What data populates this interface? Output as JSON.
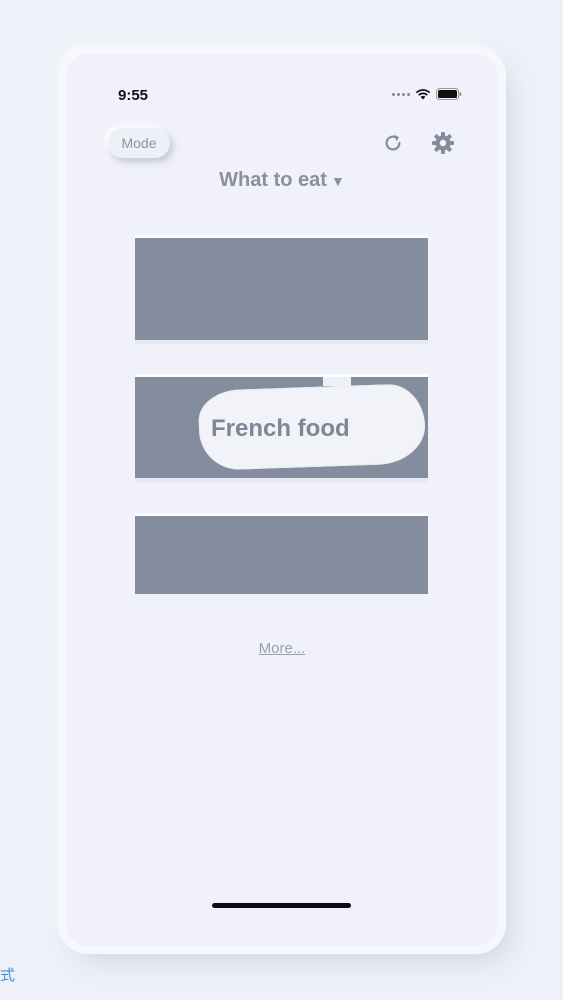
{
  "status_bar": {
    "time": "9:55"
  },
  "header": {
    "mode_label": "Mode",
    "title": "What to eat",
    "title_caret": "▼",
    "refresh_icon": "refresh-icon",
    "settings_icon": "gear-icon"
  },
  "cards": [
    {
      "label": ""
    },
    {
      "label": "French food"
    },
    {
      "label": ""
    }
  ],
  "more_link": "More...",
  "bottom_left_text": "式",
  "colors": {
    "background": "#eef1f8",
    "card": "#848d9e",
    "text_muted": "#8a909d",
    "link_blue": "#4a8fd0"
  }
}
